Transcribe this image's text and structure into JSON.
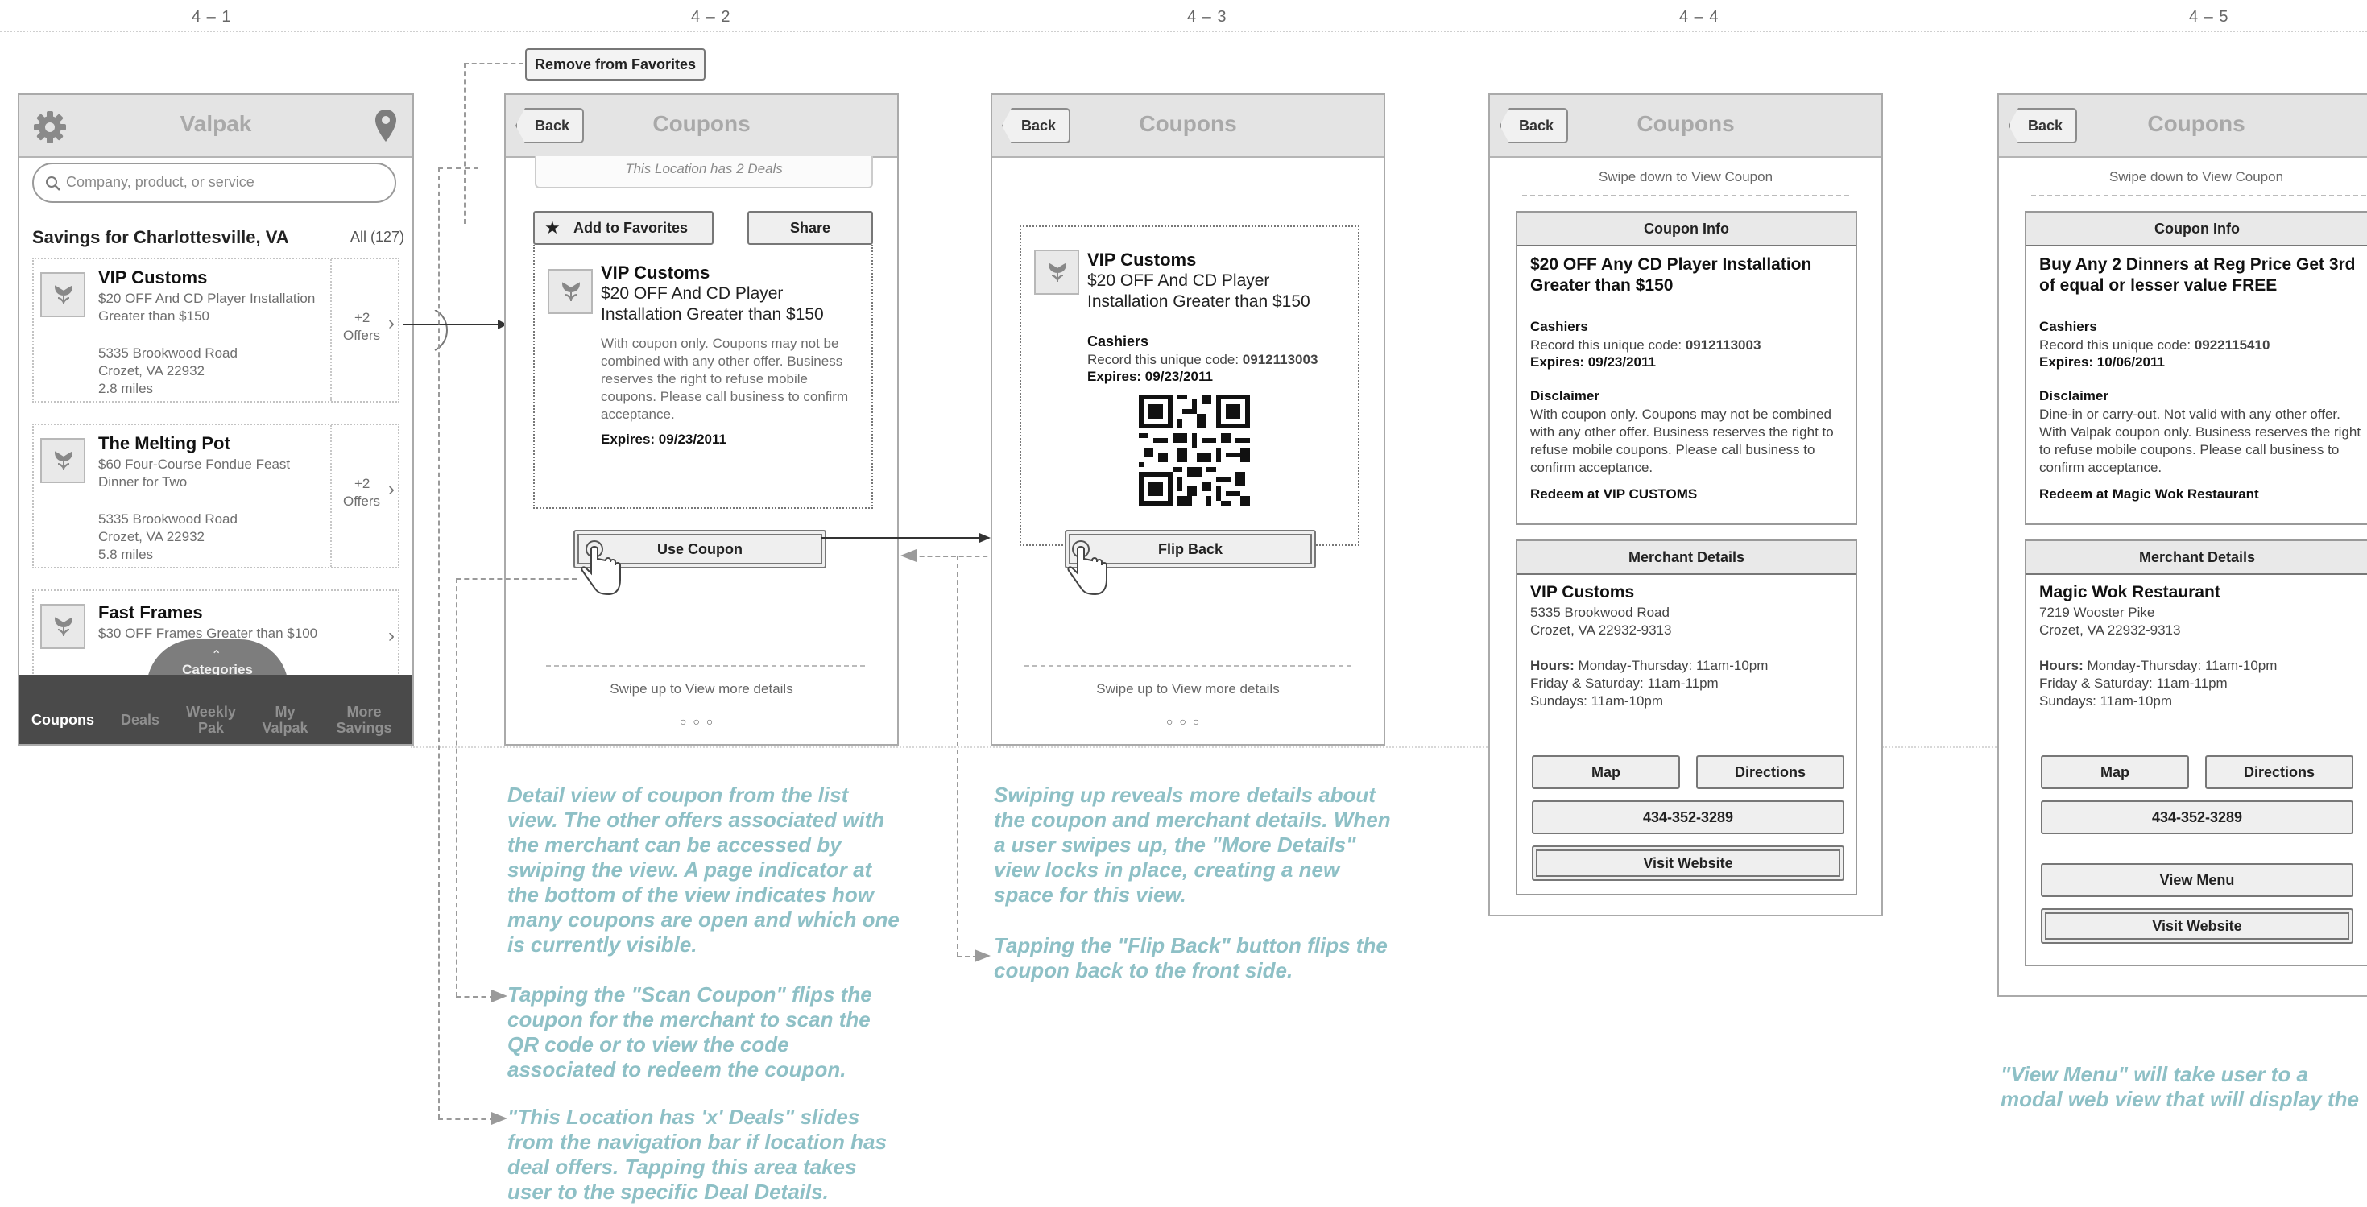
{
  "frame_labels": [
    "4 – 1",
    "4 – 2",
    "4 – 3",
    "4 – 4",
    "4 – 5"
  ],
  "popup": {
    "remove_favorites": "Remove from Favorites"
  },
  "screen1": {
    "title": "Valpak",
    "search_placeholder": "Company, product, or service",
    "section_title": "Savings for Charlottesville, VA",
    "section_count": "All (127)",
    "items": [
      {
        "name": "VIP Customs",
        "desc": "$20 OFF And CD Player Installation Greater than $150",
        "address1": "5335 Brookwood Road",
        "address2": "Crozet, VA 22932",
        "distance": "2.8 miles",
        "offers1": "+2",
        "offers2": "Offers"
      },
      {
        "name": "The Melting Pot",
        "desc": "$60 Four-Course Fondue Feast Dinner for Two",
        "address1": "5335 Brookwood Road",
        "address2": "Crozet, VA 22932",
        "distance": "5.8 miles",
        "offers1": "+2",
        "offers2": "Offers"
      },
      {
        "name": "Fast Frames",
        "desc": "$30 OFF Frames Greater than $100"
      }
    ],
    "categories_label": "Categories",
    "tabs": [
      "Coupons",
      "Deals",
      "Weekly Pak",
      "My Valpak",
      "More Savings"
    ]
  },
  "screen2": {
    "back": "Back",
    "title": "Coupons",
    "location_deals": "This Location has 2 Deals",
    "add_favorites": "Add to Favorites",
    "share": "Share",
    "merchant": "VIP Customs",
    "offer": "$20 OFF And CD Player Installation Greater than $150",
    "terms": "With coupon only. Coupons may not be combined with any other offer. Business reserves the right to refuse mobile coupons. Please call business to confirm acceptance.",
    "expires": "Expires: 09/23/2011",
    "use_coupon": "Use Coupon",
    "swipe_up": "Swipe up to View more details"
  },
  "screen3": {
    "back": "Back",
    "title": "Coupons",
    "merchant": "VIP Customs",
    "offer": "$20 OFF And CD Player Installation Greater than $150",
    "cashiers": "Cashiers",
    "record_label": "Record this unique code: ",
    "code": "0912113003",
    "expires": "Expires: 09/23/2011",
    "flip_back": "Flip Back",
    "swipe_up": "Swipe up to View more details"
  },
  "screen4": {
    "back": "Back",
    "title": "Coupons",
    "swipe_down": "Swipe down to View Coupon",
    "coupon_info_hdr": "Coupon Info",
    "headline": "$20 OFF Any CD Player Installation Greater than $150",
    "cashiers": "Cashiers",
    "record_label": "Record this unique code: ",
    "code": "0912113003",
    "expires": "Expires: 09/23/2011",
    "disclaimer_hdr": "Disclaimer",
    "disclaimer": "With coupon only. Coupons may not be combined with any other offer. Business reserves the right to refuse mobile coupons. Please call business to confirm acceptance.",
    "redeem": "Redeem at VIP CUSTOMS",
    "merchant_hdr": "Merchant Details",
    "merchant_name": "VIP Customs",
    "address1": "5335 Brookwood Road",
    "address2": "Crozet, VA 22932-9313",
    "hours_label": "Hours:",
    "hours1": " Monday-Thursday: 11am-10pm",
    "hours2": "Friday & Saturday: 11am-11pm",
    "hours3": "Sundays: 11am-10pm",
    "map": "Map",
    "directions": "Directions",
    "phone": "434-352-3289",
    "visit": "Visit Website"
  },
  "screen5": {
    "back": "Back",
    "title": "Coupons",
    "swipe_down": "Swipe down to View Coupon",
    "coupon_info_hdr": "Coupon Info",
    "headline": "Buy Any 2 Dinners at Reg Price Get 3rd of equal or lesser value FREE",
    "cashiers": "Cashiers",
    "record_label": "Record this unique code: ",
    "code": "0922115410",
    "expires": "Expires: 10/06/2011",
    "disclaimer_hdr": "Disclaimer",
    "disclaimer": "Dine-in or carry-out. Not valid with any other offer. With Valpak coupon only. Business reserves the right to refuse mobile coupons. Please call business to confirm acceptance.",
    "redeem": "Redeem at Magic Wok Restaurant",
    "merchant_hdr": "Merchant Details",
    "merchant_name": "Magic Wok Restaurant",
    "address1": "7219 Wooster Pike",
    "address2": "Crozet, VA 22932-9313",
    "hours_label": "Hours:",
    "hours1": " Monday-Thursday: 11am-10pm",
    "hours2": "Friday & Saturday: 11am-11pm",
    "hours3": "Sundays: 11am-10pm",
    "map": "Map",
    "directions": "Directions",
    "phone": "434-352-3289",
    "view_menu": "View Menu",
    "visit": "Visit Website"
  },
  "notes": {
    "n1": "Detail view of coupon from the list view. The other offers associated with the merchant can be accessed by swiping the view. A page indicator at the bottom of the view indicates how many coupons are open and which one is currently visible.",
    "n2": "Tapping the \"Scan Coupon\" flips the coupon for the merchant to scan the QR code or to view the code associated to redeem the coupon.",
    "n3": "\"This Location has 'x' Deals\" slides from the navigation bar if location has deal offers. Tapping this area takes user to the specific Deal Details.",
    "n4": "Swiping up reveals more details about the coupon and merchant details. When a user swipes up, the \"More Details\" view locks in place, creating a new space for this view.",
    "n5": "Tapping the \"Flip Back\" button flips the coupon back to the front side.",
    "n6": "\"View Menu\" will take user to a modal web view that will display the pdf."
  }
}
